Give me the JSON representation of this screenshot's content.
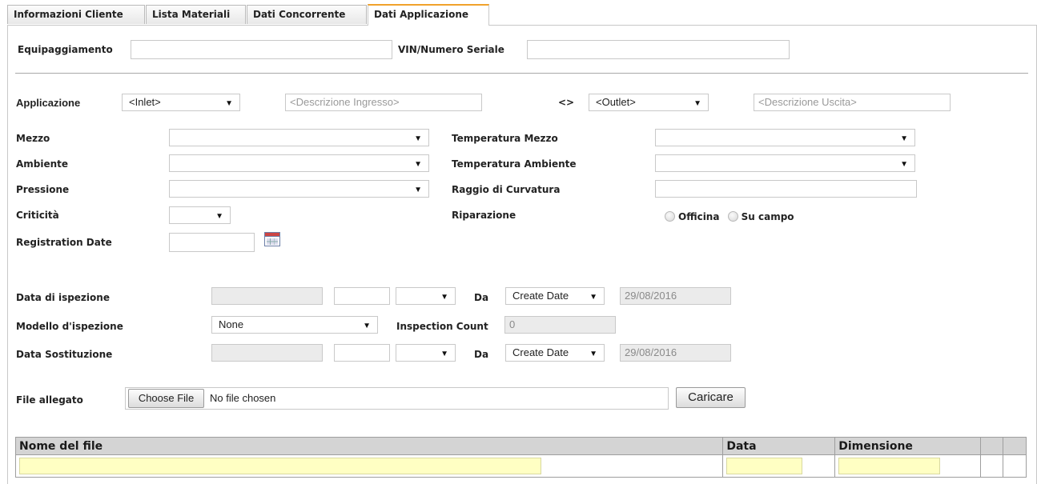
{
  "tabs": [
    {
      "label": "Informazioni Cliente",
      "active": false
    },
    {
      "label": "Lista Materiali",
      "active": false
    },
    {
      "label": "Dati Concorrente",
      "active": false
    },
    {
      "label": "Dati Applicazione",
      "active": true
    }
  ],
  "equipment": {
    "equipaggiamento_label": "Equipaggiamento",
    "equipaggiamento_value": "",
    "vin_label": "VIN/Numero Seriale",
    "vin_value": ""
  },
  "application": {
    "label": "Applicazione",
    "inlet_select": "<Inlet>",
    "inlet_desc_placeholder": "<Descrizione Ingresso>",
    "arrow_symbol": "<>",
    "outlet_select": "<Outlet>",
    "outlet_desc_placeholder": "<Descrizione Uscita>"
  },
  "conditions": {
    "mezzo_label": "Mezzo",
    "mezzo_value": "",
    "temp_mezzo_label": "Temperatura Mezzo",
    "temp_mezzo_value": "",
    "ambiente_label": "Ambiente",
    "ambiente_value": "",
    "temp_ambiente_label": "Temperatura Ambiente",
    "temp_ambiente_value": "",
    "pressione_label": "Pressione",
    "pressione_value": "",
    "raggio_label": "Raggio di Curvatura",
    "raggio_value": "",
    "criticita_label": "Criticità",
    "criticita_value": "",
    "riparazione_label": "Riparazione",
    "riparazione_options": [
      "Officina",
      "Su campo"
    ],
    "registration_label": "Registration Date",
    "registration_value": ""
  },
  "inspection": {
    "data_ispezione_label": "Data di ispezione",
    "da_label": "Da",
    "date_source": "Create Date",
    "date_value": "29/08/2016",
    "modello_label": "Modello d'ispezione",
    "modello_value": "None",
    "count_label": "Inspection Count",
    "count_value": "0",
    "sostituzione_label": "Data Sostituzione",
    "sostituzione_da_label": "Da",
    "sostituzione_source": "Create Date",
    "sostituzione_date": "29/08/2016"
  },
  "attachment": {
    "label": "File allegato",
    "choose_button": "Choose File",
    "no_file_text": "No file chosen",
    "upload_button": "Caricare"
  },
  "file_table": {
    "columns": [
      "Nome del file",
      "Data",
      "Dimensione",
      "",
      ""
    ],
    "rows": [
      [
        "",
        "",
        "",
        "",
        ""
      ]
    ]
  },
  "icons": {
    "calendar": "calendar-icon",
    "dropdown": "chevron-down-icon"
  }
}
